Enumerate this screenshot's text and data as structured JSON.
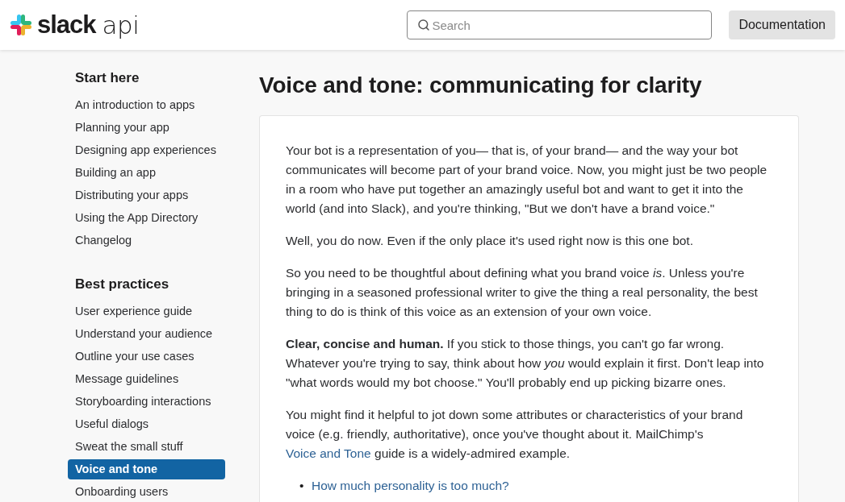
{
  "header": {
    "logo": {
      "word": "slack",
      "suffix": "api"
    },
    "search": {
      "placeholder": "Search"
    },
    "nav_button": "Documentation"
  },
  "sidebar": {
    "sections": [
      {
        "title": "Start here",
        "items": [
          {
            "label": "An introduction to apps",
            "selected": false
          },
          {
            "label": "Planning your app",
            "selected": false
          },
          {
            "label": "Designing app experiences",
            "selected": false
          },
          {
            "label": "Building an app",
            "selected": false
          },
          {
            "label": "Distributing your apps",
            "selected": false
          },
          {
            "label": "Using the App Directory",
            "selected": false
          },
          {
            "label": "Changelog",
            "selected": false
          }
        ]
      },
      {
        "title": "Best practices",
        "items": [
          {
            "label": "User experience guide",
            "selected": false
          },
          {
            "label": "Understand your audience",
            "selected": false
          },
          {
            "label": "Outline your use cases",
            "selected": false
          },
          {
            "label": "Message guidelines",
            "selected": false
          },
          {
            "label": "Storyboarding interactions",
            "selected": false
          },
          {
            "label": "Useful dialogs",
            "selected": false
          },
          {
            "label": "Sweat the small stuff",
            "selected": false
          },
          {
            "label": "Voice and tone",
            "selected": true
          },
          {
            "label": "Onboarding users",
            "selected": false
          }
        ]
      }
    ]
  },
  "article": {
    "title": "Voice and tone: communicating for clarity",
    "paragraphs": [
      [
        {
          "kind": "text",
          "text": "Your bot is a representation of you— that is, of your brand— and the way your bot communicates will become part of your brand voice. Now, you might just be two people in a room who have put together an amazingly useful bot and want to get it into the world (and into Slack), and you're thinking, \"But we don't have a brand voice.\""
        }
      ],
      [
        {
          "kind": "text",
          "text": "Well, you do now. Even if the only place it's used right now is this one bot."
        }
      ],
      [
        {
          "kind": "text",
          "text": "So you need to be thoughtful about defining what you brand voice *is*. Unless you're bringing in a seasoned professional writer to give the thing a real personality, the best thing to do is think of this voice as an extension of your own voice."
        }
      ],
      [
        {
          "kind": "text",
          "text": "**Clear, concise and human.** If you stick to those things, you can't go far wrong. Whatever you're trying to say, think about how *you* would explain it first. Don't leap into \"what words would my bot choose.\" You'll probably end up picking bizarre ones."
        }
      ],
      [
        {
          "kind": "text",
          "text": "You might find it helpful to jot down some attributes or characteristics of your brand voice (e.g. friendly, authoritative), once you've thought about it. MailChimp's "
        },
        {
          "kind": "link",
          "text": "Voice and Tone"
        },
        {
          "kind": "text",
          "text": " guide is a widely-admired example."
        }
      ]
    ],
    "links_list": [
      {
        "marker": "•",
        "text": "How much personality is too much?"
      }
    ]
  }
}
